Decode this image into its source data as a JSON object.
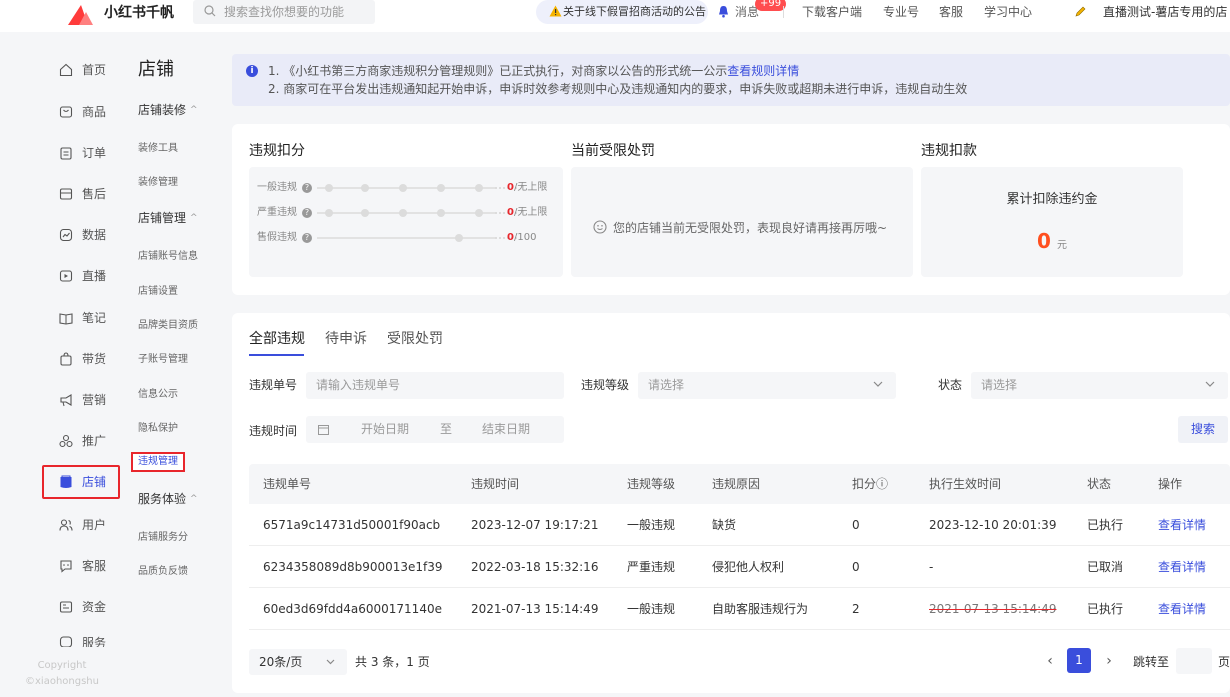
{
  "brand": {
    "name": "小红书千帆"
  },
  "search": {
    "placeholder": "搜索查找你想要的功能"
  },
  "topbar": {
    "notice": "关于线下假冒招商活动的公告",
    "message_label": "消息",
    "message_badge": "+99",
    "links": [
      "下载客户端",
      "专业号",
      "客服",
      "学习中心"
    ],
    "shop_name": "直播测试-薯店专用的店"
  },
  "sidebar": {
    "items": [
      {
        "label": "首页",
        "icon": "home-icon"
      },
      {
        "label": "商品",
        "icon": "product-icon"
      },
      {
        "label": "订单",
        "icon": "order-icon"
      },
      {
        "label": "售后",
        "icon": "after-sales-icon"
      },
      {
        "label": "数据",
        "icon": "data-icon"
      },
      {
        "label": "直播",
        "icon": "live-icon"
      },
      {
        "label": "笔记",
        "icon": "notes-icon"
      },
      {
        "label": "带货",
        "icon": "bag-icon"
      },
      {
        "label": "营销",
        "icon": "megaphone-icon"
      },
      {
        "label": "推广",
        "icon": "promotion-icon"
      },
      {
        "label": "店铺",
        "icon": "shop-icon",
        "active": true
      },
      {
        "label": "用户",
        "icon": "users-icon"
      },
      {
        "label": "客服",
        "icon": "chat-icon"
      },
      {
        "label": "资金",
        "icon": "wallet-icon"
      },
      {
        "label": "服务",
        "icon": "service-icon"
      }
    ],
    "copyright": "Copyright",
    "copyright_owner": "©xiaohongshu"
  },
  "subnav": {
    "title": "店铺",
    "groups": [
      {
        "label": "店铺装修",
        "items": [
          "装修工具",
          "装修管理"
        ]
      },
      {
        "label": "店铺管理",
        "items": [
          "店铺账号信息",
          "店铺设置",
          "品牌类目资质",
          "子账号管理",
          "信息公示",
          "隐私保护",
          "违规管理"
        ]
      },
      {
        "label": "服务体验",
        "items": [
          "店铺服务分",
          "品质负反馈"
        ]
      }
    ],
    "active_item": "违规管理"
  },
  "notice": {
    "line1_prefix": "1. 《小红书第三方商家违规积分管理规则》已正式执行，对商家以公告的形式统一公示",
    "line1_link": "查看规则详情",
    "line2": "2. 商家可在平台发出违规通知起开始申诉，申诉时效参考规则中心及违规通知内的要求，申诉失败或超期未进行申诉，违规自动生效"
  },
  "penalty": {
    "title": "违规扣分",
    "rows": [
      {
        "label": "一般违规",
        "current": "0",
        "limit": "/无上限",
        "dots": 5,
        "dashed": true
      },
      {
        "label": "严重违规",
        "current": "0",
        "limit": "/无上限",
        "dots": 5,
        "dashed": true
      },
      {
        "label": "售假违规",
        "current": "0",
        "limit": "/100",
        "dots": 2,
        "dashed": false
      }
    ]
  },
  "restriction": {
    "title": "当前受限处罚",
    "empty_text": "您的店铺当前无受限处罚，表现良好请再接再厉哦~"
  },
  "fine": {
    "title": "违规扣款",
    "label": "累计扣除违约金",
    "amount": "0",
    "unit": "元"
  },
  "tabs": [
    "全部违规",
    "待申诉",
    "受限处罚"
  ],
  "filters": {
    "violation_no_label": "违规单号",
    "violation_no_placeholder": "请输入违规单号",
    "level_label": "违规等级",
    "level_placeholder": "请选择",
    "status_label": "状态",
    "status_placeholder": "请选择",
    "time_label": "违规时间",
    "start_placeholder": "开始日期",
    "range_sep": "至",
    "end_placeholder": "结束日期",
    "search_button": "搜索"
  },
  "table": {
    "headers": [
      "违规单号",
      "违规时间",
      "违规等级",
      "违规原因",
      "扣分ⓘ",
      "执行生效时间",
      "状态",
      "操作"
    ],
    "rows": [
      [
        "6571a9c14731d50001f90acb",
        "2023-12-07 19:17:21",
        "一般违规",
        "缺货",
        "0",
        "2023-12-10 20:01:39",
        "已执行",
        "查看详情"
      ],
      [
        "6234358089d8b900013e1f39",
        "2022-03-18 15:32:16",
        "严重违规",
        "侵犯他人权利",
        "0",
        "-",
        "已取消",
        "查看详情"
      ],
      [
        "60ed3d69fdd4a6000171140e",
        "2021-07-13 15:14:49",
        "一般违规",
        "自助客服违规行为",
        "2",
        "2021-07-13 15:14:49",
        "已执行",
        "查看详情"
      ]
    ]
  },
  "pagination": {
    "page_size": "20条/页",
    "total": "共 3 条，1 页",
    "current_page": "1",
    "jump_label": "跳转至",
    "page_unit": "页"
  },
  "colors": {
    "accent": "#3a4edc",
    "alert": "#e8262c",
    "amount": "#ff4f1f"
  }
}
